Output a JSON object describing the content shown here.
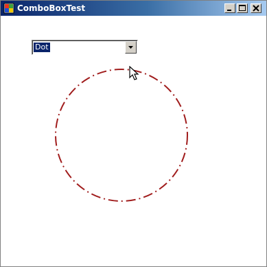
{
  "window": {
    "title": "ComboBoxTest"
  },
  "combo": {
    "selected_value": "Dot"
  },
  "drawing": {
    "shape": "circle",
    "dash_style": "dash-dot",
    "stroke_color": "#a01c1c"
  },
  "icons": {
    "app": "app-icon",
    "minimize": "minimize-icon",
    "maximize": "maximize-icon",
    "close": "close-icon",
    "dropdown": "chevron-down-icon",
    "cursor": "mouse-cursor-icon"
  }
}
